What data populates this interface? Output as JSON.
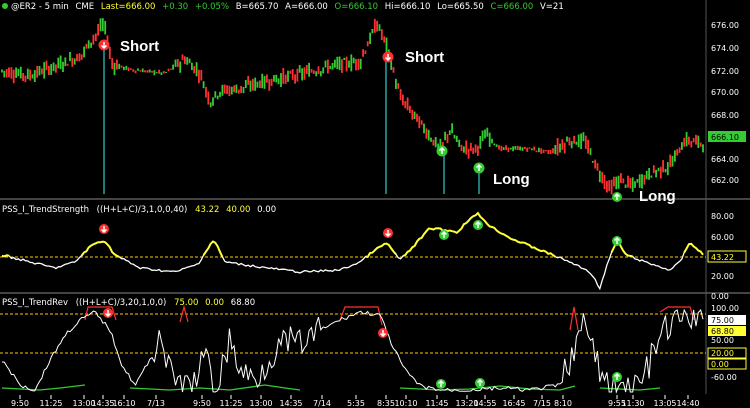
{
  "window": {
    "symbol": "@ER2 - 5 min",
    "exchange": "CME",
    "last": "Last=666.00",
    "change": "+0.30",
    "change_pct": "+0.05%",
    "bid": "B=665.70",
    "ask": "A=666.00",
    "open": "O=666.10",
    "high": "Hi=666.10",
    "low": "Lo=665.50",
    "close": "C=666.00",
    "volume": "V=21"
  },
  "price_panel": {
    "scale_labels": [
      "676.00",
      "674.00",
      "672.00",
      "670.00",
      "668.00",
      "664.00",
      "662.00"
    ],
    "last_price_tag": "666.10",
    "annotations": [
      "Short",
      "Short",
      "Long",
      "Long"
    ]
  },
  "strength_panel": {
    "title": "PSS_I_TrendStrength",
    "params": "((H+L+C)/3,1,0,0,40)",
    "value_a": "43.22",
    "value_b": "40.00",
    "value_c": "0.00",
    "scale_labels": [
      "80.00",
      "60.00",
      "20.00",
      "0.00"
    ],
    "value_tag": "43.22"
  },
  "rev_panel": {
    "title": "PSS_I_TrendRev",
    "params": "((H+L+C)/3,20,1,0,0)",
    "value_a": "75.00",
    "value_b": "0.00",
    "value_c": "68.80",
    "scale_labels": [
      "100.00",
      "50.00",
      "-60.00"
    ],
    "tags": [
      "75.00",
      "68.80",
      "20.00",
      "0.00"
    ]
  },
  "time_axis": [
    "9:50",
    "11:25",
    "13:00",
    "14:35",
    "16:10",
    "7/13",
    "9:50",
    "11:25",
    "13:00",
    "14:35",
    "7/14",
    "5:35",
    "8:35",
    "10:10",
    "11:45",
    "13:20",
    "14:55",
    "16:45",
    "7/15",
    "8:10",
    "9:55",
    "11:30",
    "13:05",
    "14:40"
  ],
  "colors": {
    "background": "#000000",
    "up_bar": "#33cc33",
    "down_bar": "#ff3030",
    "strength_line": "#ffffff",
    "strength_high": "#ffff33",
    "signal_line": "#33cccc",
    "short_marker": "#ff3030",
    "long_marker": "#33cc33",
    "level_line": "#ffcc00"
  }
}
